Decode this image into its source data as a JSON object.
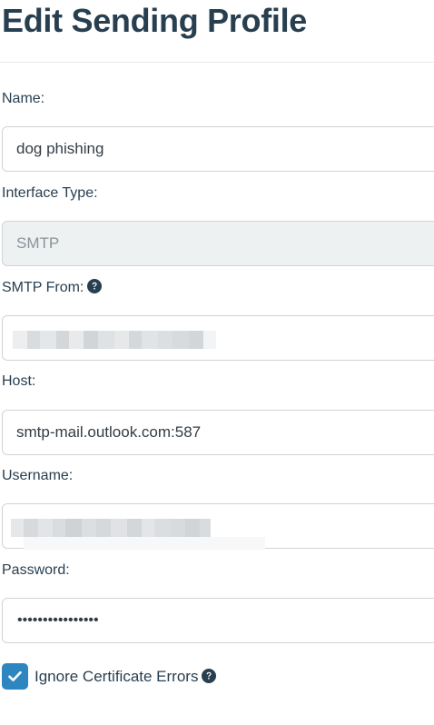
{
  "page_title": "Edit Sending Profile",
  "form": {
    "name": {
      "label": "Name:",
      "value": "dog phishing"
    },
    "interface_type": {
      "label": "Interface Type:",
      "value": "SMTP"
    },
    "smtp_from": {
      "label": "SMTP From:",
      "value": ""
    },
    "host": {
      "label": "Host:",
      "value": "smtp-mail.outlook.com:587"
    },
    "username": {
      "label": "Username:",
      "value": ""
    },
    "password": {
      "label": "Password:",
      "value": "••••••••••••••••"
    },
    "ignore_cert": {
      "label": "Ignore Certificate Errors",
      "checked": true
    }
  },
  "colors": {
    "accent": "#2e86c1",
    "text": "#283f50",
    "border": "#d0d4d8",
    "disabled_bg": "#eef1f2"
  },
  "icons": {
    "help": "question-circle-icon",
    "check": "check-icon"
  }
}
